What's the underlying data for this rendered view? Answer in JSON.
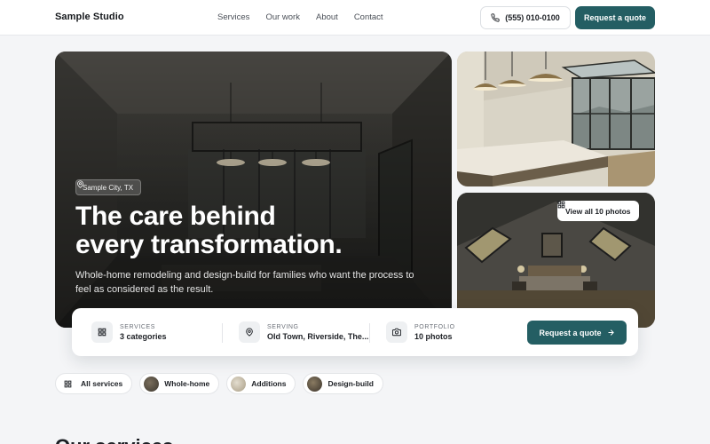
{
  "header": {
    "brand": "Sample Studio",
    "nav": [
      "Services",
      "Our work",
      "About",
      "Contact"
    ],
    "phone": "(555) 010-0100",
    "cta": "Request a quote"
  },
  "hero": {
    "location": "Sample City, TX",
    "title_line1": "The care behind",
    "title_line2": "every transformation.",
    "subtitle": "Whole-home remodeling and design-build for families who want the process to feel as considered as the result.",
    "view_all": "View all 10 photos"
  },
  "info": {
    "services": {
      "label": "SERVICES",
      "value": "3 categories"
    },
    "serving": {
      "label": "SERVING",
      "value": "Old Town, Riverside, The..."
    },
    "portfolio": {
      "label": "PORTFOLIO",
      "value": "10 photos"
    },
    "cta": "Request a quote"
  },
  "filters": [
    "All services",
    "Whole-home",
    "Additions",
    "Design-build"
  ],
  "section": {
    "heading": "Our services"
  },
  "icons": {
    "phone": "phone-icon",
    "pin": "map-pin-icon",
    "grid": "grid-icon",
    "camera": "camera-icon",
    "arrow": "arrow-right-icon"
  },
  "colors": {
    "accent": "#245e63",
    "background": "#f4f5f7"
  }
}
